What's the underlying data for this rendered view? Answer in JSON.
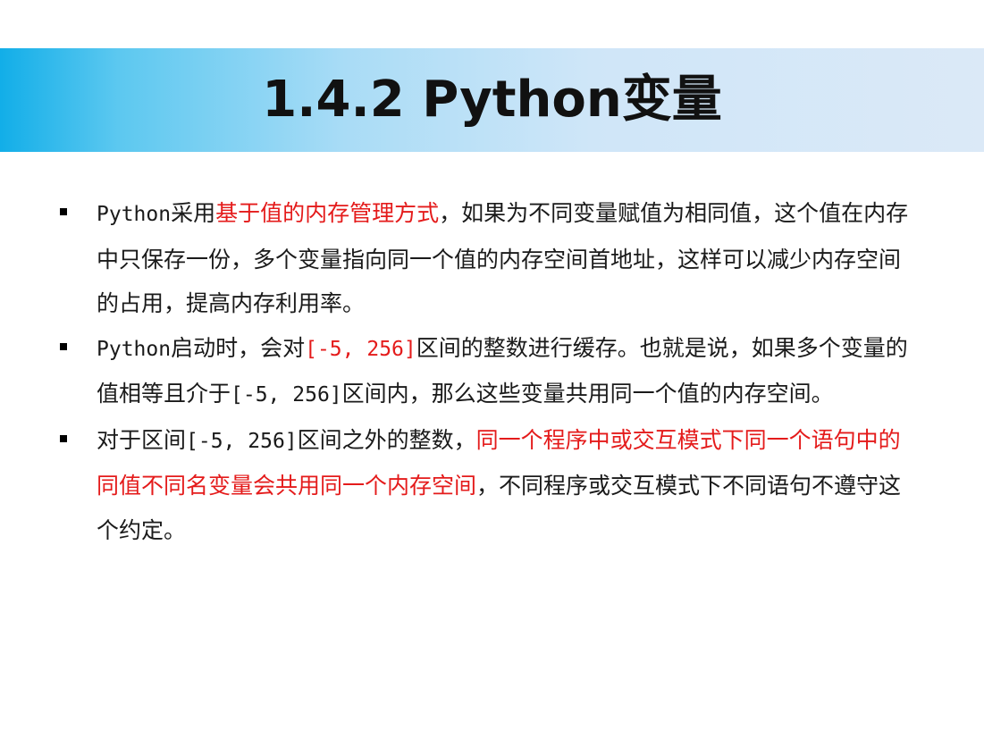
{
  "title": "1.4.2 Python变量",
  "colors": {
    "accent_red": "#e41b1b",
    "title_band_start": "#12aee8",
    "title_band_end": "#dbe9f7"
  },
  "bullets": [
    {
      "segments": [
        {
          "text": "Python",
          "style": "mono"
        },
        {
          "text": "采用",
          "style": "normal"
        },
        {
          "text": "基于值的内存管理方式",
          "style": "red"
        },
        {
          "text": "，如果为不同变量赋值为相同值，这个值在内存中只保存一份，多个变量指向同一个值的内存空间首地址，这样可以减少内存空间的占用，提高内存利用率。",
          "style": "normal"
        }
      ]
    },
    {
      "segments": [
        {
          "text": "Python",
          "style": "mono"
        },
        {
          "text": "启动时，会对",
          "style": "normal"
        },
        {
          "text": "[-5, 256]",
          "style": "mono-red"
        },
        {
          "text": "区间的整数进行缓存。也就是说，如果多个变量的值相等且介于",
          "style": "normal"
        },
        {
          "text": "[-5, 256]",
          "style": "mono"
        },
        {
          "text": "区间内，那么这些变量共用同一个值的内存空间。",
          "style": "normal"
        }
      ]
    },
    {
      "segments": [
        {
          "text": "对于区间",
          "style": "normal"
        },
        {
          "text": "[-5, 256]",
          "style": "mono"
        },
        {
          "text": "区间之外的整数，",
          "style": "normal"
        },
        {
          "text": "同一个程序中或交互模式下同一个语句中的同值不同名变量会共用同一个内存空间",
          "style": "red"
        },
        {
          "text": "，不同程序或交互模式下不同语句不遵守这个约定。",
          "style": "normal"
        }
      ]
    }
  ]
}
